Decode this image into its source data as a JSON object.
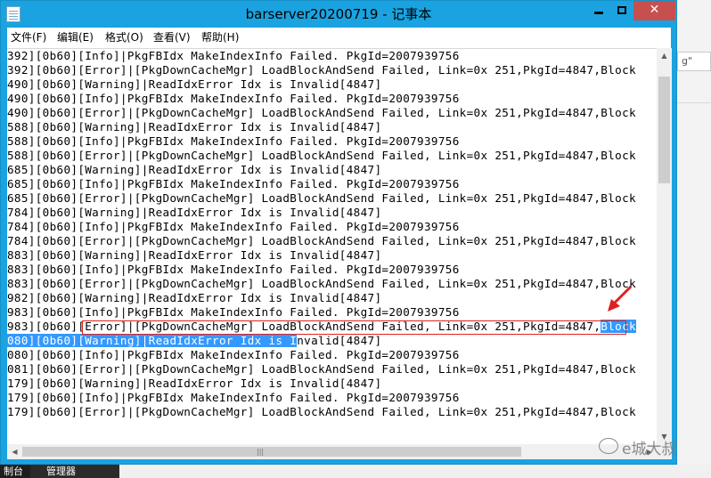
{
  "window": {
    "title": "barserver20200719 - 记事本",
    "minimize_glyph": "—",
    "maximize_glyph": "□",
    "close_glyph": "✕"
  },
  "menu": {
    "items": [
      "文件(F)",
      "编辑(E)",
      "格式(O)",
      "查看(V)",
      "帮助(H)"
    ]
  },
  "editor": {
    "lines": [
      "392][0b60][Info]|PkgFBIdx MakeIndexInfo Failed. PkgId=2007939756",
      "392][0b60][Error]|[PkgDownCacheMgr] LoadBlockAndSend Failed, Link=0x 251,PkgId=4847,Block",
      "490][0b60][Warning]|ReadIdxError Idx is Invalid[4847]",
      "490][0b60][Info]|PkgFBIdx MakeIndexInfo Failed. PkgId=2007939756",
      "490][0b60][Error]|[PkgDownCacheMgr] LoadBlockAndSend Failed, Link=0x 251,PkgId=4847,Block",
      "588][0b60][Warning]|ReadIdxError Idx is Invalid[4847]",
      "588][0b60][Info]|PkgFBIdx MakeIndexInfo Failed. PkgId=2007939756",
      "588][0b60][Error]|[PkgDownCacheMgr] LoadBlockAndSend Failed, Link=0x 251,PkgId=4847,Block",
      "685][0b60][Warning]|ReadIdxError Idx is Invalid[4847]",
      "685][0b60][Info]|PkgFBIdx MakeIndexInfo Failed. PkgId=2007939756",
      "685][0b60][Error]|[PkgDownCacheMgr] LoadBlockAndSend Failed, Link=0x 251,PkgId=4847,Block",
      "784][0b60][Warning]|ReadIdxError Idx is Invalid[4847]",
      "784][0b60][Info]|PkgFBIdx MakeIndexInfo Failed. PkgId=2007939756",
      "784][0b60][Error]|[PkgDownCacheMgr] LoadBlockAndSend Failed, Link=0x 251,PkgId=4847,Block",
      "883][0b60][Warning]|ReadIdxError Idx is Invalid[4847]",
      "883][0b60][Info]|PkgFBIdx MakeIndexInfo Failed. PkgId=2007939756",
      "883][0b60][Error]|[PkgDownCacheMgr] LoadBlockAndSend Failed, Link=0x 251,PkgId=4847,Block",
      "982][0b60][Warning]|ReadIdxError Idx is Invalid[4847]",
      "983][0b60][Info]|PkgFBIdx MakeIndexInfo Failed. PkgId=2007939756",
      "983][0b60][Error]|[PkgDownCacheMgr] LoadBlockAndSend Failed, Link=0x 251,PkgId=4847,",
      "080][0b60][Warning]|ReadIdxError Idx is I",
      "080][0b60][Info]|PkgFBIdx MakeIndexInfo Failed. PkgId=2007939756",
      "081][0b60][Error]|[PkgDownCacheMgr] LoadBlockAndSend Failed, Link=0x 251,PkgId=4847,Block",
      "179][0b60][Warning]|ReadIdxError Idx is Invalid[4847]",
      "179][0b60][Info]|PkgFBIdx MakeIndexInfo Failed. PkgId=2007939756",
      "179][0b60][Error]|[PkgDownCacheMgr] LoadBlockAndSend Failed, Link=0x 251,PkgId=4847,Block"
    ],
    "selected_tail_line19": "Block",
    "line20_rest": "nvalid[4847]"
  },
  "background": {
    "fragment_text": "g\"",
    "taskbar_item_1": "制台",
    "taskbar_item_2": "管理器"
  },
  "watermark": {
    "text": "e城大叔"
  },
  "colors": {
    "title_bar": "#1aa3e0",
    "close_button": "#c7504f",
    "selection": "#3399ff",
    "annotation": "#e02020"
  }
}
